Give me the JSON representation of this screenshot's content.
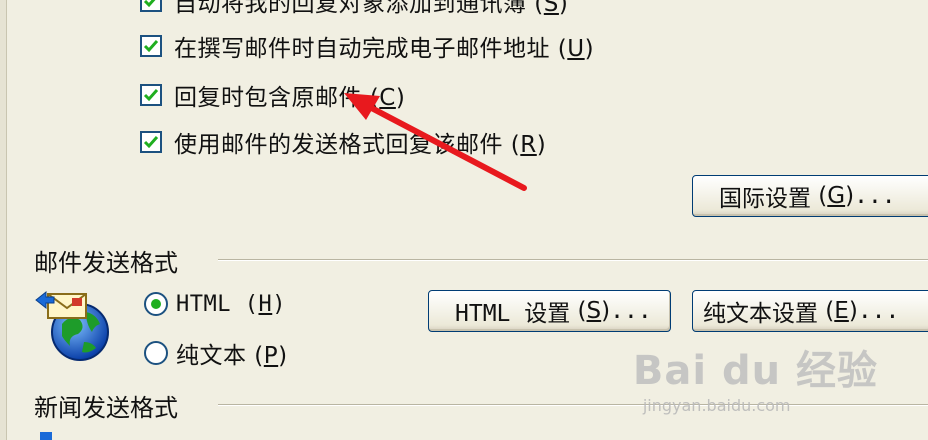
{
  "options": [
    {
      "text": "自动将我的回复对象添加到通讯簿",
      "key": "S",
      "checked": true
    },
    {
      "text": "在撰写邮件时自动完成电子邮件地址",
      "key": "U",
      "checked": true
    },
    {
      "text": "回复时包含原邮件",
      "key": "C",
      "checked": true
    },
    {
      "text": "使用邮件的发送格式回复该邮件",
      "key": "R",
      "checked": true
    }
  ],
  "buttons": {
    "intl": {
      "text": "国际设置",
      "key": "G",
      "suffix": "..."
    },
    "html": {
      "text": "HTML 设置",
      "key": "S",
      "suffix": "..."
    },
    "plain": {
      "text": "纯文本设置",
      "key": "E",
      "suffix": "..."
    }
  },
  "mail_format": {
    "title": "邮件发送格式",
    "html_option": {
      "text": "HTML",
      "key": "H",
      "selected": true
    },
    "plain_option": {
      "text": "纯文本",
      "key": "P",
      "selected": false
    }
  },
  "news_format": {
    "title": "新闻发送格式"
  },
  "annotation": {
    "color": "#e8191e"
  },
  "watermark": {
    "main": "Bai du 经验",
    "sub": "jingyan.baidu.com"
  },
  "icons": {
    "mail_globe": "mail-globe-icon",
    "check": "check-icon"
  },
  "colors": {
    "background": "#f1efe2",
    "check": "#1fae1f",
    "border": "#1c5180"
  }
}
